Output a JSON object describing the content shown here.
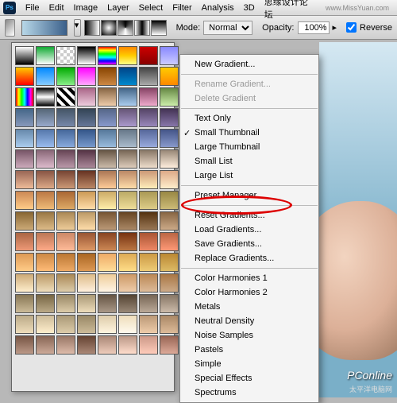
{
  "menu": {
    "items": [
      "File",
      "Edit",
      "Image",
      "Layer",
      "Select",
      "Filter",
      "Analysis",
      "3D",
      "思缘设计论坛",
      "www.MissYuan.com"
    ]
  },
  "toolbar": {
    "mode_label": "Mode:",
    "mode_value": "Normal",
    "opacity_label": "Opacity:",
    "opacity_value": "100%",
    "reverse_label": "Reverse"
  },
  "context": {
    "new": "New Gradient...",
    "rename": "Rename Gradient...",
    "delete": "Delete Gradient",
    "text_only": "Text Only",
    "small_thumb": "Small Thumbnail",
    "large_thumb": "Large Thumbnail",
    "small_list": "Small List",
    "large_list": "Large List",
    "preset_mgr": "Preset Manager...",
    "reset": "Reset Gradients...",
    "load": "Load Gradients...",
    "save": "Save Gradients...",
    "replace": "Replace Gradients...",
    "ch1": "Color Harmonies 1",
    "ch2": "Color Harmonies 2",
    "metals": "Metals",
    "neutral": "Neutral Density",
    "noise": "Noise Samples",
    "pastels": "Pastels",
    "simple": "Simple",
    "fx": "Special Effects",
    "spectrums": "Spectrums"
  },
  "swatches": [
    "linear-gradient(#fff,#000)",
    "linear-gradient(#1a3,#fff)",
    "repeating-conic-gradient(#ccc 0 25%,#fff 0 50%) 0 0/8px 8px",
    "linear-gradient(#000,#fff)",
    "linear-gradient(#f00,#ff0,#0f0,#0ff,#00f,#f0f)",
    "linear-gradient(#f80,#fc0,#ff8)",
    "linear-gradient(#c00,#800)",
    "linear-gradient(#88f,#ccf)",
    "linear-gradient(#fc0,#f00)",
    "linear-gradient(#08f,#8cf)",
    "linear-gradient(#0a0,#8e8)",
    "linear-gradient(#f0f,#faf)",
    "linear-gradient(#840,#c84)",
    "linear-gradient(#048,#08c)",
    "linear-gradient(#444,#aaa)",
    "linear-gradient(#fc0,#f80)",
    "linear-gradient(90deg,#f00,#ff0,#0f0,#0ff,#00f,#f0f,#f00)",
    "linear-gradient(#000,#fff,#000)",
    "repeating-linear-gradient(45deg,#000 0 4px,#fff 4px 8px)",
    "linear-gradient(#a68,#ecd)",
    "linear-gradient(#864,#eca)",
    "linear-gradient(#468,#ace)",
    "linear-gradient(#846,#eac)",
    "linear-gradient(#684,#cea)",
    "linear-gradient(#446688,#8899bb)",
    "linear-gradient(#556677,#99aacc)",
    "linear-gradient(#445566,#7788aa)",
    "linear-gradient(#334455,#667799)",
    "linear-gradient(#556688,#8899cc)",
    "linear-gradient(#665577,#aa99cc)",
    "linear-gradient(#554466,#9988bb)",
    "linear-gradient(#443355,#8877aa)",
    "linear-gradient(#6688aa,#aaccee)",
    "linear-gradient(#5577aa,#99bbee)",
    "linear-gradient(#446699,#88aadd)",
    "linear-gradient(#335588,#7799cc)",
    "linear-gradient(#557799,#99bbdd)",
    "linear-gradient(#667788,#aabbcc)",
    "linear-gradient(#556699,#99aadd)",
    "linear-gradient(#445588,#8899cc)",
    "linear-gradient(#775566,#ccaabb)",
    "linear-gradient(#886677,#ddbbcc)",
    "linear-gradient(#664455,#bb99aa)",
    "linear-gradient(#553344,#aa8899)",
    "linear-gradient(#665544,#ccbbaa)",
    "linear-gradient(#776655,#ddccbb)",
    "linear-gradient(#887766,#eeddcc)",
    "linear-gradient(#998877,#ffeedd)",
    "linear-gradient(#996655,#eebb99)",
    "linear-gradient(#885544,#ddaa88)",
    "linear-gradient(#774433,#cc9977)",
    "linear-gradient(#663322,#bb8866)",
    "linear-gradient(#aa7755,#ffcc99)",
    "linear-gradient(#bb8866,#ffddaa)",
    "linear-gradient(#cc9977,#ffeebb)",
    "linear-gradient(#ddaa88,#ffeecc)",
    "linear-gradient(#cc8855,#ffcc88)",
    "linear-gradient(#bb7744,#eebb77)",
    "linear-gradient(#aa6633,#ddaa66)",
    "linear-gradient(#cc9955,#ffddaa)",
    "linear-gradient(#ccaa66,#ffeeaa)",
    "linear-gradient(#bbaa66,#eedd99)",
    "linear-gradient(#aa9955,#ddcc88)",
    "linear-gradient(#998844,#ccbb77)",
    "linear-gradient(#886633,#ccaa77)",
    "linear-gradient(#997744,#ddbb88)",
    "linear-gradient(#aa8855,#eecc99)",
    "linear-gradient(#bb9966,#ffddaa)",
    "linear-gradient(#775533,#bb9977)",
    "linear-gradient(#664422,#aa8866)",
    "linear-gradient(#553311,#997755)",
    "linear-gradient(#886644,#ccaa88)",
    "linear-gradient(#aa6644,#ee9977)",
    "linear-gradient(#bb7755,#ffaa88)",
    "linear-gradient(#cc8866,#ffbb99)",
    "linear-gradient(#995533,#dd9966)",
    "linear-gradient(#884422,#cc8855)",
    "linear-gradient(#773311,#bb7744)",
    "linear-gradient(#aa5533,#ee8866)",
    "linear-gradient(#bb6644,#ff9977)",
    "linear-gradient(#dd9955,#ffcc88)",
    "linear-gradient(#cc8844,#ffbb77)",
    "linear-gradient(#bb7733,#eeaa66)",
    "linear-gradient(#aa6622,#dd9955)",
    "linear-gradient(#eeaa66,#ffdd99)",
    "linear-gradient(#ddaa55,#ffdd88)",
    "linear-gradient(#cc9944,#eecc77)",
    "linear-gradient(#bb8833,#ddbb66)",
    "linear-gradient(#ccaa77,#ffeecc)",
    "linear-gradient(#bb9966,#eeddbb)",
    "linear-gradient(#aa8855,#ddccaa)",
    "linear-gradient(#ddbb88,#fff0dd)",
    "linear-gradient(#eecc99,#fff5e5)",
    "linear-gradient(#cc9966,#eeccaa)",
    "linear-gradient(#bb8855,#ddbb99)",
    "linear-gradient(#aa7744,#ccaa88)",
    "linear-gradient(#887755,#ccbb99)",
    "linear-gradient(#776644,#bbaa88)",
    "linear-gradient(#998866,#ddccaa)",
    "linear-gradient(#aa9977,#eeddbb)",
    "linear-gradient(#665544,#aa9988)",
    "linear-gradient(#554433,#998877)",
    "linear-gradient(#776655,#bbaa99)",
    "linear-gradient(#887766,#ccbbaa)",
    "linear-gradient(#bbaa88,#eeddbb)",
    "linear-gradient(#ccbb99,#ffeecc)",
    "linear-gradient(#aa9977,#ddccaa)",
    "linear-gradient(#998866,#ccbb99)",
    "linear-gradient(#ddccaa,#fff5e0)",
    "linear-gradient(#eeddbb,#fffaee)",
    "linear-gradient(#bb9977,#eeccaa)",
    "linear-gradient(#aa8866,#ddbb99)",
    "linear-gradient(#775544,#bb9988)",
    "linear-gradient(#886655,#ccaa99)",
    "linear-gradient(#997766,#ddbbaa)",
    "linear-gradient(#664433,#aa8877)",
    "linear-gradient(#aa8877,#eeccbb)",
    "linear-gradient(#bb9988,#ffddcc)",
    "linear-gradient(#cc9988,#ffccbb)",
    "linear-gradient(#996655,#ddaa99)"
  ],
  "watermark": {
    "main": "PConline",
    "sub": "太平洋电脑网"
  }
}
